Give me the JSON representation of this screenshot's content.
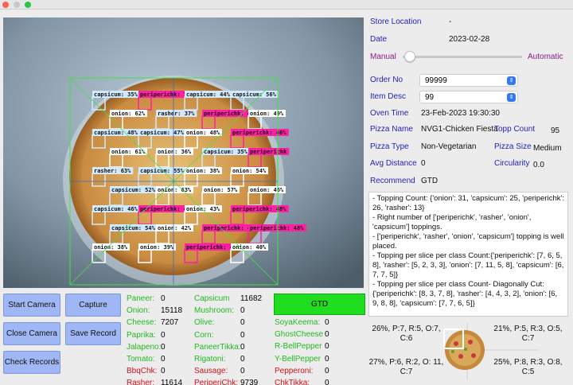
{
  "window": {
    "buttons": [
      "close",
      "minimize",
      "zoom"
    ]
  },
  "camera": {
    "detections": [
      {
        "label": "capsicum: 35%",
        "type": "capsicum"
      },
      {
        "label": "periperichk: 70%",
        "type": "periperichk"
      },
      {
        "label": "capsicum: 44%",
        "type": "capsicum"
      },
      {
        "label": "capsicum: 56%",
        "type": "capsicum"
      },
      {
        "label": "onion: 62%",
        "type": "onion"
      },
      {
        "label": "rasher: 37%",
        "type": "rasher"
      },
      {
        "label": "periperichk: 46%",
        "type": "periperichk"
      },
      {
        "label": "onion: 49%",
        "type": "onion"
      },
      {
        "label": "capsicum: 48%",
        "type": "capsicum"
      },
      {
        "label": "capsicum: 47%",
        "type": "capsicum"
      },
      {
        "label": "onion: 48%",
        "type": "onion"
      },
      {
        "label": "periperichk: 46%",
        "type": "periperichk"
      },
      {
        "label": "onion: 61%",
        "type": "onion"
      },
      {
        "label": "onion: 36%",
        "type": "onion"
      },
      {
        "label": "capsicum: 35%",
        "type": "capsicum"
      },
      {
        "label": "periperichk",
        "type": "periperichk"
      },
      {
        "label": "rasher: 63%",
        "type": "rasher"
      },
      {
        "label": "capsicum: 55%",
        "type": "capsicum"
      },
      {
        "label": "onion: 38%",
        "type": "onion"
      },
      {
        "label": "onion: 54%",
        "type": "onion"
      },
      {
        "label": "capsicum: 52%",
        "type": "capsicum"
      },
      {
        "label": "onion: 63%",
        "type": "onion"
      },
      {
        "label": "onion: 57%",
        "type": "onion"
      },
      {
        "label": "onion: 46%",
        "type": "onion"
      },
      {
        "label": "capsicum: 46%",
        "type": "capsicum"
      },
      {
        "label": "periperichk: 48%",
        "type": "periperichk"
      },
      {
        "label": "onion: 43%",
        "type": "onion"
      },
      {
        "label": "periperichk: 48%",
        "type": "periperichk"
      },
      {
        "label": "capsicum: 54%",
        "type": "capsicum"
      },
      {
        "label": "onion: 42%",
        "type": "onion"
      },
      {
        "label": "periperichk: 46%",
        "type": "periperichk"
      },
      {
        "label": "periperichk: 48%",
        "type": "periperichk"
      },
      {
        "label": "onion: 38%",
        "type": "onion"
      },
      {
        "label": "onion: 39%",
        "type": "onion"
      },
      {
        "label": "periperichk: 46%",
        "type": "periperichk"
      },
      {
        "label": "onion: 40%",
        "type": "onion"
      }
    ]
  },
  "buttons": {
    "start_camera": "Start Camera",
    "capture": "Capture",
    "close_camera": "Close Camera",
    "save_record": "Save Record",
    "check_records": "Check Records",
    "gtd": "GTD"
  },
  "counts": {
    "col1": [
      {
        "label": "Paneer:",
        "value": "0",
        "color": "#22b922"
      },
      {
        "label": "Onion:",
        "value": "15118",
        "color": "#22b922"
      },
      {
        "label": "Cheese:",
        "value": "7207",
        "color": "#22b922"
      },
      {
        "label": "Paprika:",
        "value": "0",
        "color": "#22b922"
      },
      {
        "label": "Jalapeno:",
        "value": "0",
        "color": "#22b922"
      },
      {
        "label": "Tomato:",
        "value": "0",
        "color": "#22b922"
      },
      {
        "label": "BbqChk:",
        "value": "0",
        "color": "#d0111d"
      },
      {
        "label": "Rasher:",
        "value": "11614",
        "color": "#d0111d"
      }
    ],
    "col2": [
      {
        "label": "Capsicum",
        "value": "11682",
        "color": "#22b922"
      },
      {
        "label": "Mushroom:",
        "value": "0",
        "color": "#22b922"
      },
      {
        "label": "Olive:",
        "value": "0",
        "color": "#22b922"
      },
      {
        "label": "Corn:",
        "value": "0",
        "color": "#22b922"
      },
      {
        "label": "PaneerTikka:",
        "value": "0",
        "color": "#22b922"
      },
      {
        "label": "Rigatoni:",
        "value": "0",
        "color": "#22b922"
      },
      {
        "label": "Sausage:",
        "value": "0",
        "color": "#d0111d"
      },
      {
        "label": "PeriperiChk:",
        "value": "9739",
        "color": "#d0111d"
      }
    ],
    "col3": [
      {
        "label": "SoyaKeema:",
        "value": "0",
        "color": "#22b922"
      },
      {
        "label": "GhostCheese",
        "value": "0",
        "color": "#22b922"
      },
      {
        "label": "R-BellPepper",
        "value": "0",
        "color": "#22b922"
      },
      {
        "label": "Y-BellPepper",
        "value": "0",
        "color": "#22b922"
      },
      {
        "label": "Pepperoni:",
        "value": "0",
        "color": "#d0111d"
      },
      {
        "label": "ChkTikka:",
        "value": "0",
        "color": "#d0111d"
      }
    ]
  },
  "info": {
    "store_location_label": "Store Location",
    "store_location_value": "-",
    "date_label": "Date",
    "date_value": "2023-02-28",
    "manual_label": "Manual",
    "automatic_label": "Automatic",
    "order_no_label": "Order No",
    "order_no_value": "99999",
    "item_desc_label": "Item Desc",
    "item_desc_value": "99",
    "oven_time_label": "Oven Time",
    "oven_time_value": "23-Feb-2023 19:30:30",
    "pizza_name_label": "Pizza Name",
    "pizza_name_value": "NVG1-Chicken Fiesta",
    "topp_count_label": "Topp Count",
    "topp_count_value": "95",
    "pizza_type_label": "Pizza Type",
    "pizza_type_value": "Non-Vegetarian",
    "pizza_size_label": "Pizza Size",
    "pizza_size_value": "Medium",
    "avg_distance_label": "Avg Distance",
    "avg_distance_value": "0",
    "circularity_label": "Circularity",
    "circularity_value": "0.0",
    "recommend_label": "Recommend",
    "recommend_value": "GTD"
  },
  "log": [
    "- Topping Count: {'onion': 31, 'capsicum': 25, 'periperichk': 26, 'rasher': 13}",
    "- Right number of ['periperichk', 'rasher', 'onion', 'capsicum'] toppings.",
    "- ['periperichk', 'rasher', 'onion', 'capsicum'] topping is well placed.",
    "- Topping per slice per class Count:{'periperichk': [7, 6, 5, 8], 'rasher': [5, 2, 3, 3], 'onion': [7, 11, 5, 8], 'capsicum': [6, 7, 7, 5]}",
    "- Topping per slice per class Count- Diagonally Cut: {'periperichk': [8, 3, 7, 8], 'rasher': [4, 4, 3, 2], 'onion': [6, 9, 8, 8], 'capsicum': [7, 7, 6, 5]}"
  ],
  "slices": {
    "top_left": "26%, P:7, R:5, O:7, C:6",
    "top_right": "21%, P:5, R:3, O:5, C:7",
    "bottom_left": "27%, P:6, R:2, O: 11, C:7",
    "bottom_right": "25%, P:8, R:3, O:8, C:5"
  },
  "colors": {
    "button": "#9fb7f5",
    "gtd": "#20dd20",
    "label_blue": "#1f1fb8",
    "veg_green": "#22b922",
    "nonveg_red": "#d0111d",
    "periperichk_box": "#ff1fa5",
    "capsicum_box": "#cfe9ff",
    "onion_box": "#ffffff",
    "rasher_box": "#d6e8f8"
  }
}
